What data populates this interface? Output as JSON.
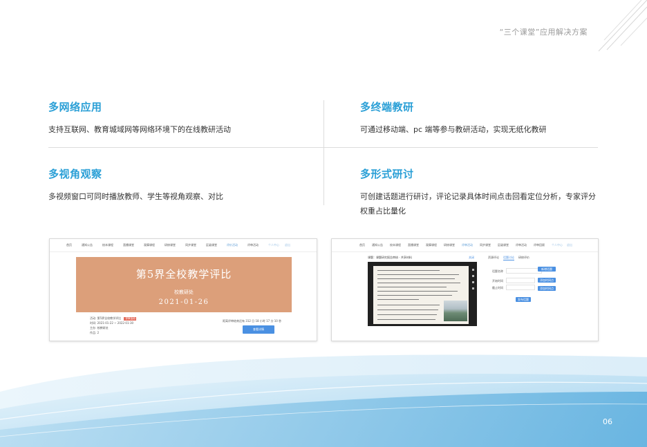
{
  "header": {
    "title": "“三个课堂”应用解决方案"
  },
  "features": [
    {
      "title": "多网络应用",
      "desc": "支持互联网、教育城域网等网络环境下的在线教研活动"
    },
    {
      "title": "多终端教研",
      "desc": "可通过移动端、pc 端等参与教研活动，实现无纸化教研"
    },
    {
      "title": "多视角观察",
      "desc": "多视频窗口可同时播放教师、学生等视角观察、对比"
    },
    {
      "title": "多形式研讨",
      "desc": "可创建话题进行研讨，评论记录具体时间点击回看定位分析，专家评分权重占比量化"
    }
  ],
  "left_shot": {
    "nav": [
      "首页",
      "通知公告",
      "校本课程",
      "直播课堂",
      "观摩课程",
      "研修课堂",
      "同步课堂",
      "区级课堂",
      "评价活动",
      "评审活动",
      "个人中心",
      "退出"
    ],
    "banner": {
      "title": "第5界全校教学评比",
      "subtitle": "校教研处",
      "date": "2021-01-26"
    },
    "info": {
      "name_label": "活动:",
      "name_value": "第5界全校教学评比",
      "tag": "评审活动",
      "time_label": "时间:",
      "time_value": "2021-01-22 ~ 2022-01-30",
      "org_label": "主办:",
      "org_value": "校教研处",
      "works_label": "作品:",
      "works_value": "2"
    },
    "right_text": "距离评审结束还有 312 日 18 小时 17 分 10 秒",
    "button": "查看详情"
  },
  "right_shot": {
    "nav": [
      "首页",
      "通知公告",
      "校本课程",
      "直播课堂",
      "观摩课程",
      "研修课堂",
      "评审活动",
      "同步课堂",
      "区级课堂",
      "评审活动",
      "评审回顾",
      "个人中心",
      "退出"
    ],
    "breadcrumb": "课题：课题研究报告审核 · 共享材料",
    "toolbar_link": "关闭",
    "tabs": [
      "资源评论",
      "话题讨论",
      "研修评价"
    ],
    "fields": [
      "话题名称",
      "开始时间",
      "截止时间"
    ],
    "buttons": [
      "新增话题",
      "添加时间点",
      "添加时间点",
      "发布话题"
    ]
  },
  "page_number": "06"
}
